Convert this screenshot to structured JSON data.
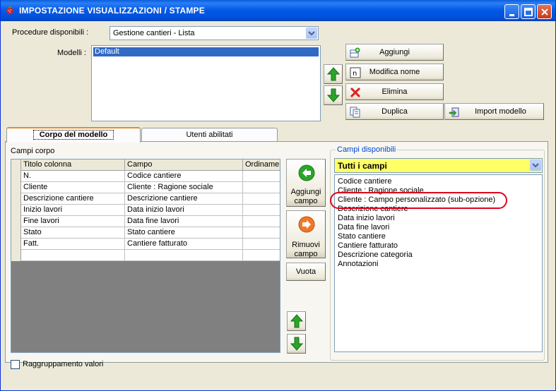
{
  "window": {
    "title": "IMPOSTAZIONE VISUALIZZAZIONI / STAMPE"
  },
  "procedures": {
    "label": "Procedure disponibili :",
    "selected": "Gestione cantieri - Lista"
  },
  "models": {
    "label": "Modelli :",
    "items": [
      "Default"
    ]
  },
  "model_buttons": {
    "add": "Aggiungi",
    "rename": "Modifica nome",
    "delete": "Elimina",
    "duplicate": "Duplica",
    "import": "Import modello"
  },
  "tabs": [
    {
      "label": "Corpo del modello",
      "active": true
    },
    {
      "label": "Utenti abilitati",
      "active": false
    }
  ],
  "body_fields": {
    "label": "Campi corpo",
    "columns": [
      "Titolo colonna",
      "Campo",
      "Ordinamento"
    ],
    "rows": [
      [
        "N.",
        "Codice cantiere",
        ""
      ],
      [
        "Cliente",
        "Cliente : Ragione sociale",
        ""
      ],
      [
        "Descrizione cantiere",
        "Descrizione cantiere",
        ""
      ],
      [
        "Inizio lavori",
        "Data inizio lavori",
        ""
      ],
      [
        "Fine lavori",
        "Data fine lavori",
        ""
      ],
      [
        "Stato",
        "Stato cantiere",
        ""
      ],
      [
        "Fatt.",
        "Cantiere fatturato",
        ""
      ],
      [
        "",
        "",
        ""
      ]
    ]
  },
  "field_actions": {
    "add_line1": "Aggiungi",
    "add_line2": "campo",
    "remove_line1": "Rimuovi",
    "remove_line2": "campo",
    "clear": "Vuota"
  },
  "available_fields": {
    "title": "Campi disponibili",
    "filter": "Tutti i campi",
    "items": [
      "Codice cantiere",
      "Cliente : Ragione sociale",
      "Cliente : Campo personalizzato (sub-opzione)",
      "Descrizione cantiere",
      "Data inizio lavori",
      "Data fine lavori",
      "Stato cantiere",
      "Cantiere fatturato",
      "Descrizione categoria",
      "Annotazioni"
    ]
  },
  "grouping": {
    "label": "Raggruppamento valori",
    "checked": false
  },
  "colors": {
    "titlebar": "#0058e6",
    "highlight": "#316ac5",
    "filter_bg": "#ffff66",
    "annotation": "#e0001b",
    "arrow_green": "#2aa52a"
  }
}
